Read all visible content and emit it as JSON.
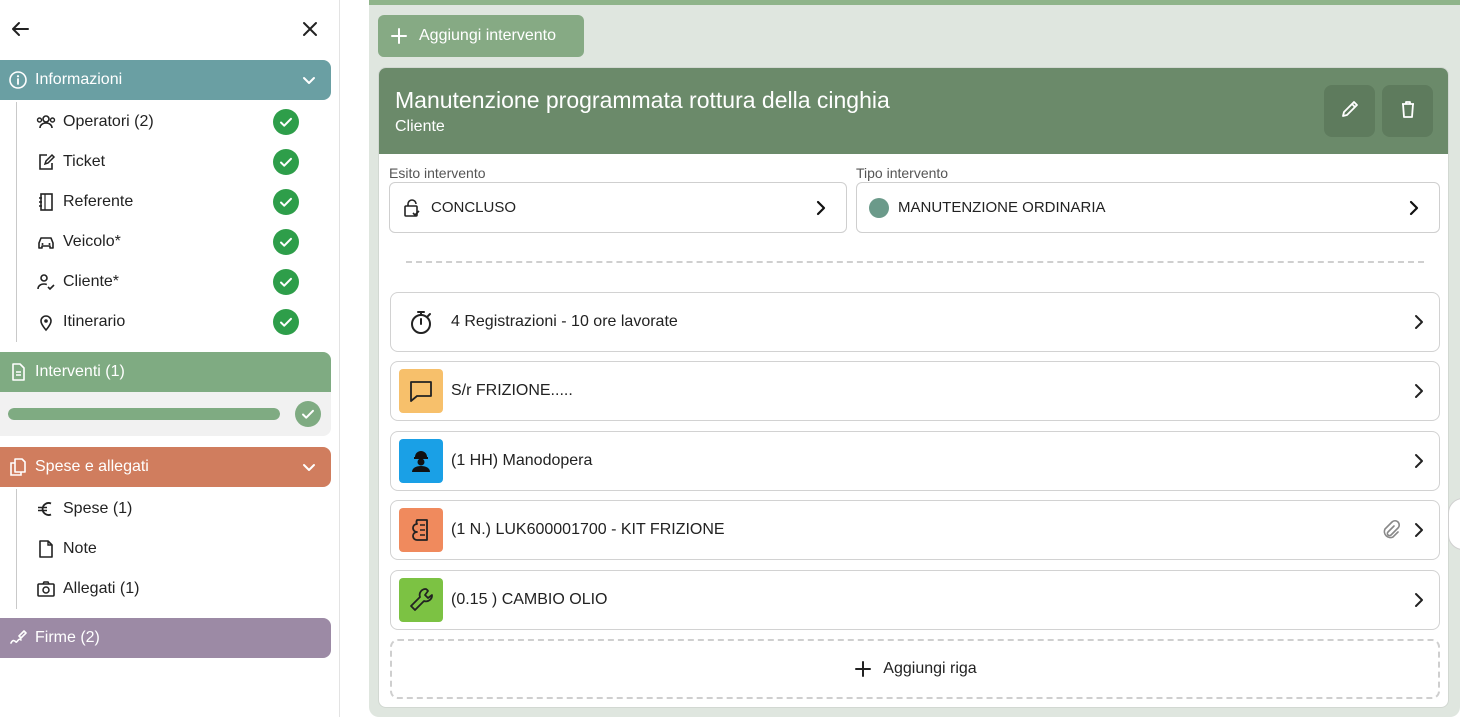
{
  "sidebar": {
    "informazioni": {
      "label": "Informazioni",
      "color": "#6a9fa3",
      "items": [
        {
          "label": "Operatori (2)",
          "icon": "users-icon",
          "done": true
        },
        {
          "label": "Ticket",
          "icon": "ticket-edit-icon",
          "done": true
        },
        {
          "label": "Referente",
          "icon": "contact-book-icon",
          "done": true
        },
        {
          "label": "Veicolo*",
          "icon": "car-icon",
          "done": true
        },
        {
          "label": "Cliente*",
          "icon": "user-check-icon",
          "done": true
        },
        {
          "label": "Itinerario",
          "icon": "map-pin-icon",
          "done": true
        }
      ]
    },
    "interventi": {
      "label": "Interventi (1)",
      "color": "#7fab82",
      "progress": 1.0
    },
    "spese": {
      "label": "Spese e allegati",
      "color": "#d07d5e",
      "items": [
        {
          "label": "Spese (1)",
          "icon": "euro-icon"
        },
        {
          "label": "Note",
          "icon": "note-icon"
        },
        {
          "label": "Allegati (1)",
          "icon": "camera-icon"
        }
      ]
    },
    "firme": {
      "label": "Firme (2)",
      "color": "#9c8aa5"
    }
  },
  "main": {
    "add_intervento_label": "Aggiungi intervento",
    "card": {
      "title": "Manutenzione programmata rottura della cinghia",
      "subtitle": "Cliente",
      "header_color": "#6b8a6a",
      "esito": {
        "label": "Esito intervento",
        "value": "CONCLUSO"
      },
      "tipo": {
        "label": "Tipo intervento",
        "value": "MANUTENZIONE ORDINARIA",
        "dot_color": "#6b9a8a"
      },
      "rows": [
        {
          "label": "4 Registrazioni - 10 ore lavorate",
          "icon": "stopwatch-icon"
        },
        {
          "label": "S/r FRIZIONE.....",
          "icon": "comment-icon",
          "icon_bg": "#f7c06b"
        },
        {
          "label": "(1 HH) Manodopera",
          "icon": "worker-icon",
          "icon_bg": "#1aa0e6"
        },
        {
          "label": "(1 N.) LUK600001700 - KIT FRIZIONE",
          "icon": "parts-icon",
          "icon_bg": "#f08a5d",
          "attachment": true
        },
        {
          "label": "(0.15 ) CAMBIO OLIO",
          "icon": "wrench-icon",
          "icon_bg": "#7cc243"
        }
      ],
      "add_row_label": "Aggiungi riga"
    }
  }
}
